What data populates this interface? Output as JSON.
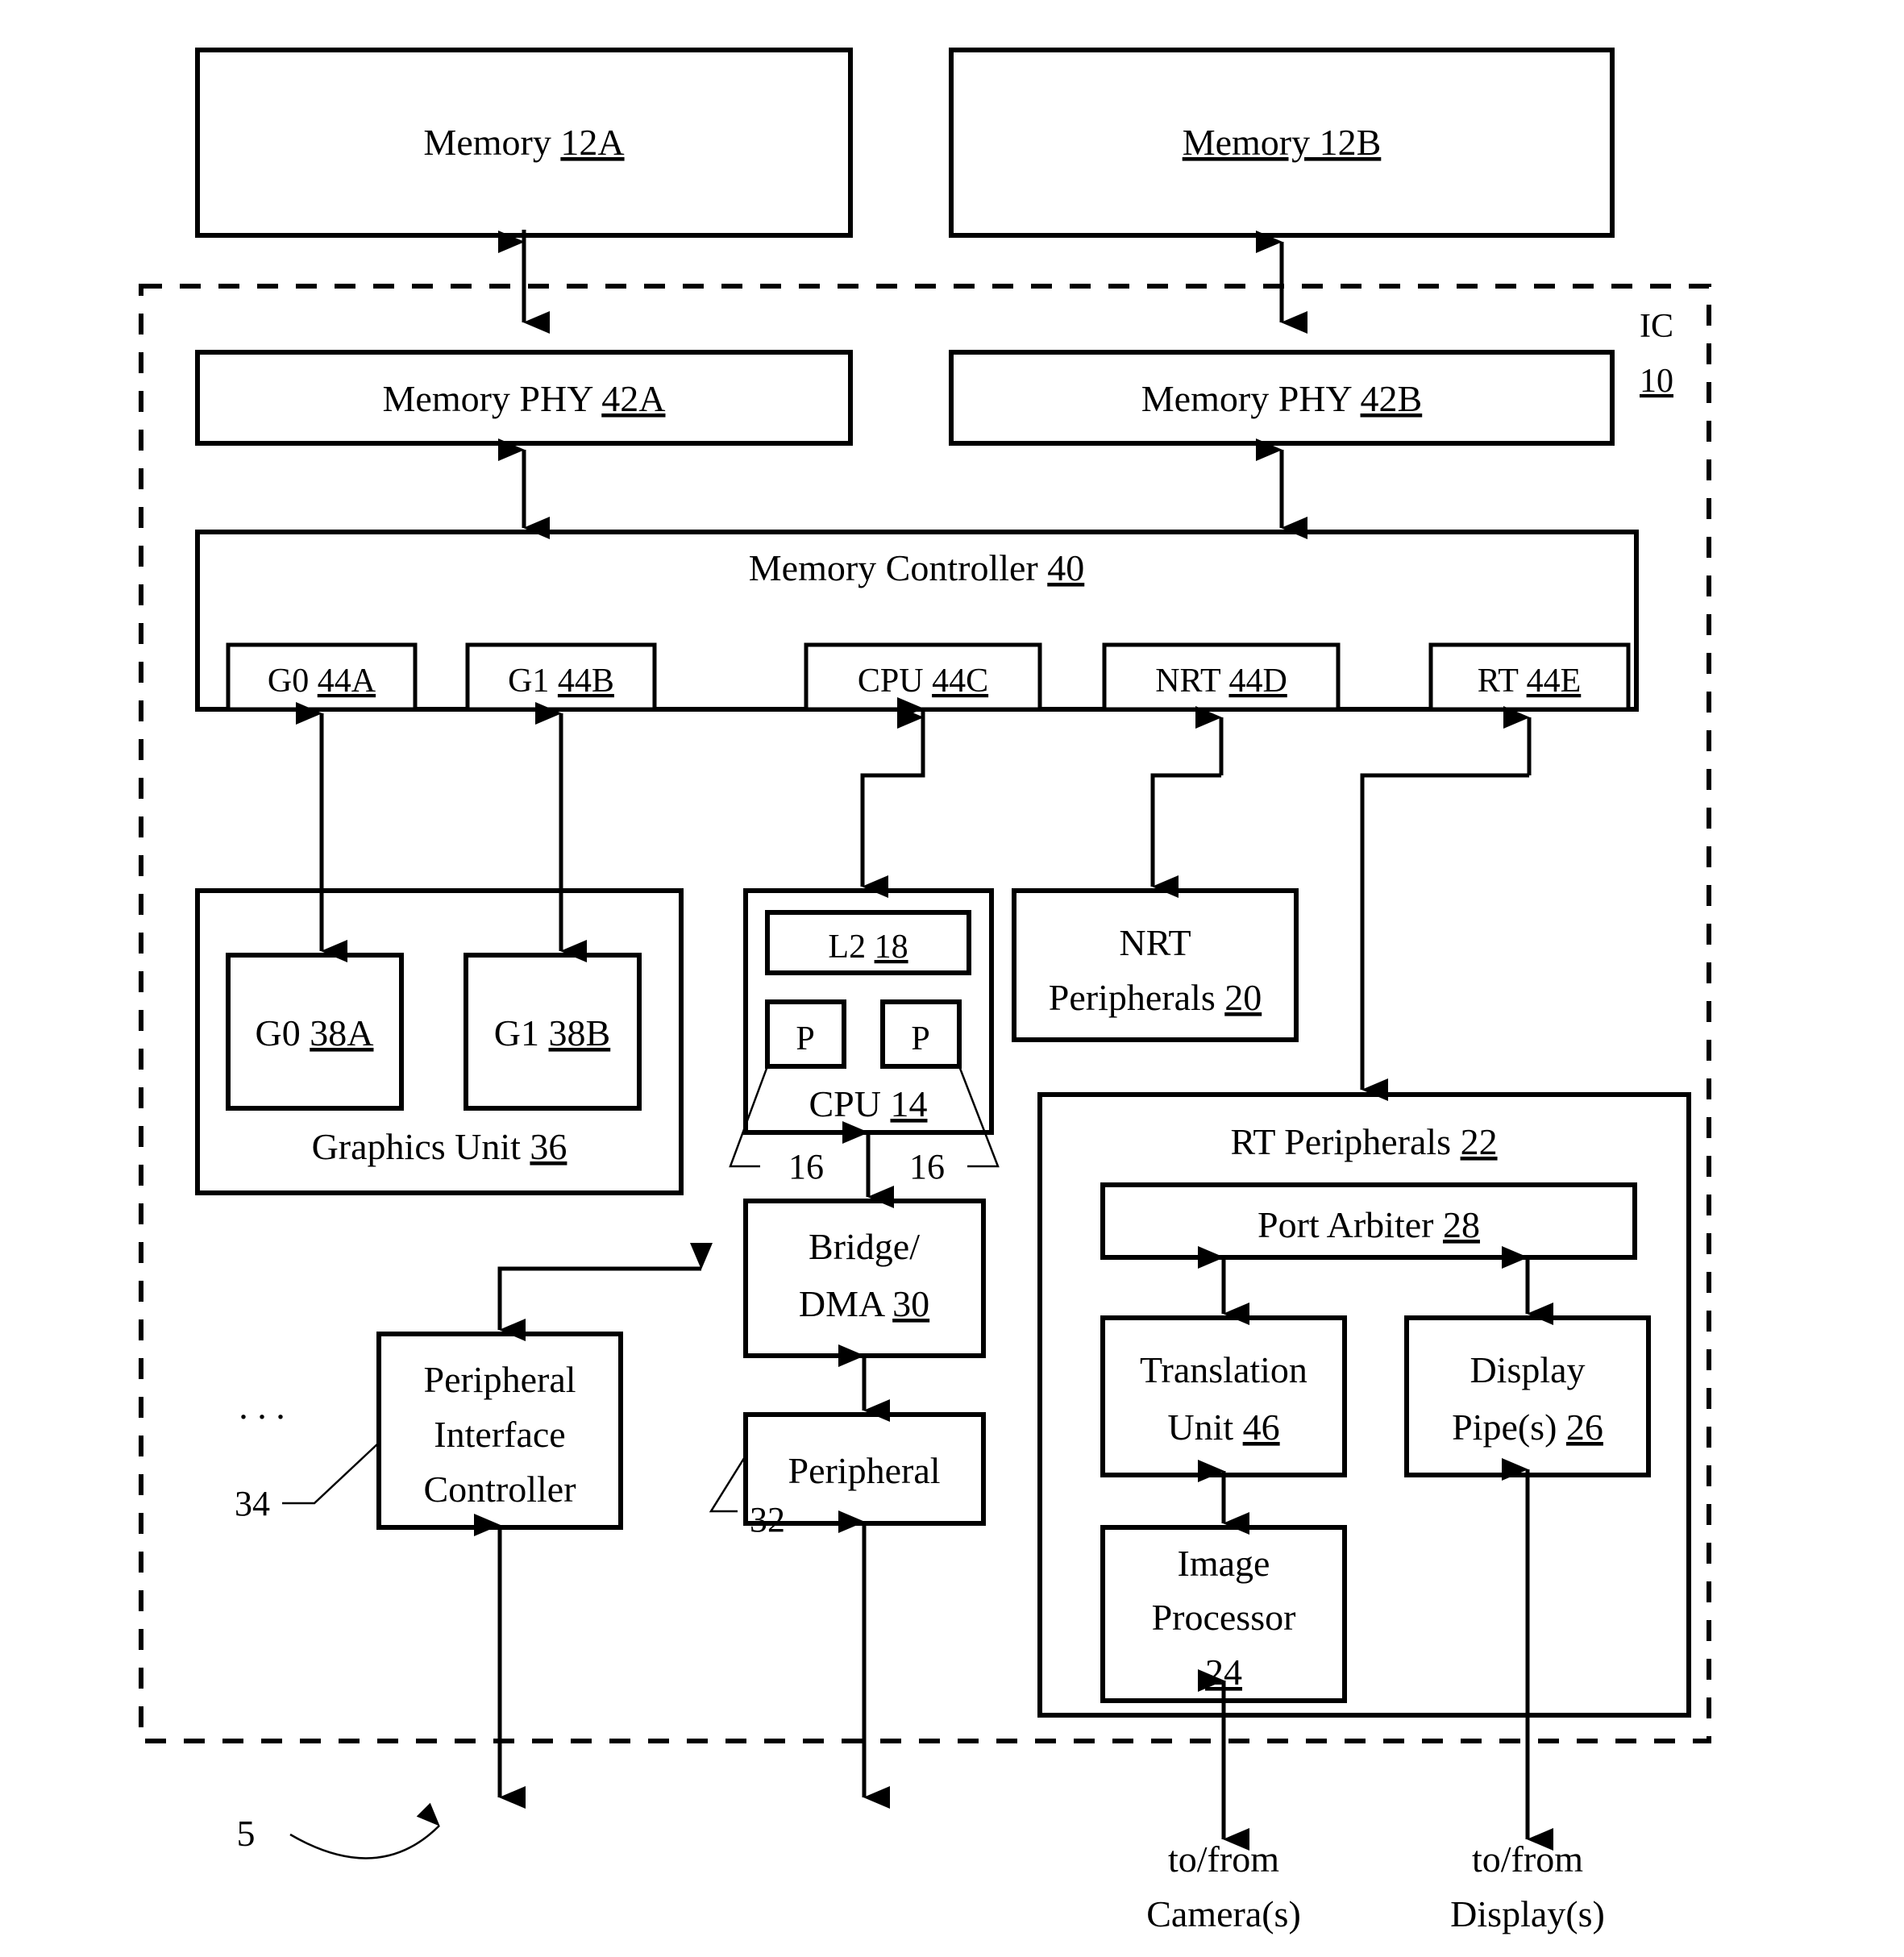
{
  "figure": {
    "type": "patent-block-diagram",
    "ic_boundary_label_line1": "IC",
    "ic_boundary_label_line2": "10",
    "figure_ref": "5",
    "ellipsis": ". . ."
  },
  "blocks": {
    "memory_a": {
      "text": "Memory ",
      "ref": "12A"
    },
    "memory_b": {
      "text": "Memory 12B",
      "ref": ""
    },
    "phy_a": {
      "text": "Memory PHY ",
      "ref": "42A"
    },
    "phy_b": {
      "text": "Memory PHY ",
      "ref": "42B"
    },
    "mem_controller": {
      "text": "Memory Controller ",
      "ref": "40"
    },
    "ports": [
      {
        "text": "G0 ",
        "ref": "44A"
      },
      {
        "text": "G1 ",
        "ref": "44B"
      },
      {
        "text": "CPU ",
        "ref": "44C"
      },
      {
        "text": "NRT ",
        "ref": "44D"
      },
      {
        "text": "RT ",
        "ref": "44E"
      }
    ],
    "graphics_unit": {
      "text": "Graphics Unit ",
      "ref": "36"
    },
    "g0": {
      "text": "G0 ",
      "ref": "38A"
    },
    "g1": {
      "text": "G1 ",
      "ref": "38B"
    },
    "l2": {
      "text": "L2 ",
      "ref": "18"
    },
    "p_left": {
      "text": "P"
    },
    "p_right": {
      "text": "P"
    },
    "cpu": {
      "text": "CPU ",
      "ref": "14"
    },
    "cpu_core_ref_left": "16",
    "cpu_core_ref_right": "16",
    "nrt_peripherals": {
      "line1": "NRT",
      "line2": "Peripherals ",
      "ref": "20"
    },
    "rt_peripherals": {
      "text": "RT Peripherals ",
      "ref": "22"
    },
    "port_arbiter": {
      "text": "Port Arbiter ",
      "ref": "28"
    },
    "translation_unit": {
      "line1": "Translation",
      "line2": "Unit ",
      "ref": "46"
    },
    "display_pipes": {
      "line1": "Display",
      "line2": "Pipe(s) ",
      "ref": "26"
    },
    "image_processor": {
      "line1": "Image",
      "line2": "Processor",
      "ref": "24"
    },
    "bridge_dma": {
      "line1": "Bridge/",
      "line2": "DMA ",
      "ref": "30"
    },
    "peripheral": {
      "text": "Peripheral",
      "ref": "32"
    },
    "peripheral_interface_controller": {
      "line1": "Peripheral",
      "line2": "Interface",
      "line3": "Controller",
      "ref": "34"
    }
  },
  "external_labels": {
    "camera": {
      "line1": "to/from",
      "line2": "Camera(s)"
    },
    "display": {
      "line1": "to/from",
      "line2": "Display(s)"
    }
  },
  "colors": {
    "stroke": "#000000",
    "fill": "#ffffff"
  }
}
